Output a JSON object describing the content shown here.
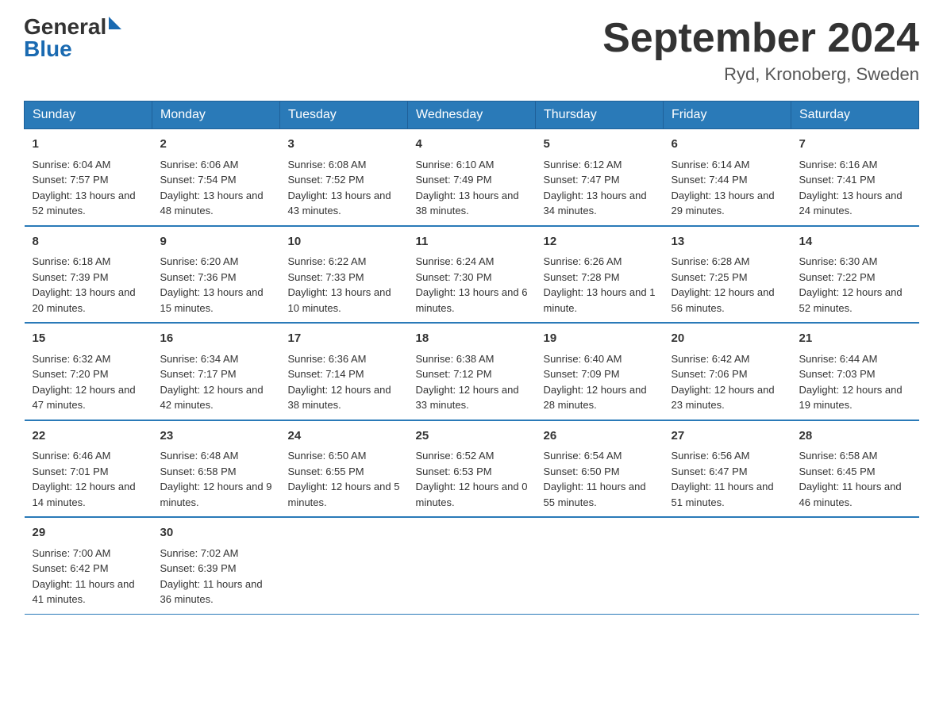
{
  "logo": {
    "general": "General",
    "blue": "Blue"
  },
  "title": "September 2024",
  "location": "Ryd, Kronoberg, Sweden",
  "days_of_week": [
    "Sunday",
    "Monday",
    "Tuesday",
    "Wednesday",
    "Thursday",
    "Friday",
    "Saturday"
  ],
  "weeks": [
    [
      {
        "day": "1",
        "sunrise": "6:04 AM",
        "sunset": "7:57 PM",
        "daylight": "13 hours and 52 minutes."
      },
      {
        "day": "2",
        "sunrise": "6:06 AM",
        "sunset": "7:54 PM",
        "daylight": "13 hours and 48 minutes."
      },
      {
        "day": "3",
        "sunrise": "6:08 AM",
        "sunset": "7:52 PM",
        "daylight": "13 hours and 43 minutes."
      },
      {
        "day": "4",
        "sunrise": "6:10 AM",
        "sunset": "7:49 PM",
        "daylight": "13 hours and 38 minutes."
      },
      {
        "day": "5",
        "sunrise": "6:12 AM",
        "sunset": "7:47 PM",
        "daylight": "13 hours and 34 minutes."
      },
      {
        "day": "6",
        "sunrise": "6:14 AM",
        "sunset": "7:44 PM",
        "daylight": "13 hours and 29 minutes."
      },
      {
        "day": "7",
        "sunrise": "6:16 AM",
        "sunset": "7:41 PM",
        "daylight": "13 hours and 24 minutes."
      }
    ],
    [
      {
        "day": "8",
        "sunrise": "6:18 AM",
        "sunset": "7:39 PM",
        "daylight": "13 hours and 20 minutes."
      },
      {
        "day": "9",
        "sunrise": "6:20 AM",
        "sunset": "7:36 PM",
        "daylight": "13 hours and 15 minutes."
      },
      {
        "day": "10",
        "sunrise": "6:22 AM",
        "sunset": "7:33 PM",
        "daylight": "13 hours and 10 minutes."
      },
      {
        "day": "11",
        "sunrise": "6:24 AM",
        "sunset": "7:30 PM",
        "daylight": "13 hours and 6 minutes."
      },
      {
        "day": "12",
        "sunrise": "6:26 AM",
        "sunset": "7:28 PM",
        "daylight": "13 hours and 1 minute."
      },
      {
        "day": "13",
        "sunrise": "6:28 AM",
        "sunset": "7:25 PM",
        "daylight": "12 hours and 56 minutes."
      },
      {
        "day": "14",
        "sunrise": "6:30 AM",
        "sunset": "7:22 PM",
        "daylight": "12 hours and 52 minutes."
      }
    ],
    [
      {
        "day": "15",
        "sunrise": "6:32 AM",
        "sunset": "7:20 PM",
        "daylight": "12 hours and 47 minutes."
      },
      {
        "day": "16",
        "sunrise": "6:34 AM",
        "sunset": "7:17 PM",
        "daylight": "12 hours and 42 minutes."
      },
      {
        "day": "17",
        "sunrise": "6:36 AM",
        "sunset": "7:14 PM",
        "daylight": "12 hours and 38 minutes."
      },
      {
        "day": "18",
        "sunrise": "6:38 AM",
        "sunset": "7:12 PM",
        "daylight": "12 hours and 33 minutes."
      },
      {
        "day": "19",
        "sunrise": "6:40 AM",
        "sunset": "7:09 PM",
        "daylight": "12 hours and 28 minutes."
      },
      {
        "day": "20",
        "sunrise": "6:42 AM",
        "sunset": "7:06 PM",
        "daylight": "12 hours and 23 minutes."
      },
      {
        "day": "21",
        "sunrise": "6:44 AM",
        "sunset": "7:03 PM",
        "daylight": "12 hours and 19 minutes."
      }
    ],
    [
      {
        "day": "22",
        "sunrise": "6:46 AM",
        "sunset": "7:01 PM",
        "daylight": "12 hours and 14 minutes."
      },
      {
        "day": "23",
        "sunrise": "6:48 AM",
        "sunset": "6:58 PM",
        "daylight": "12 hours and 9 minutes."
      },
      {
        "day": "24",
        "sunrise": "6:50 AM",
        "sunset": "6:55 PM",
        "daylight": "12 hours and 5 minutes."
      },
      {
        "day": "25",
        "sunrise": "6:52 AM",
        "sunset": "6:53 PM",
        "daylight": "12 hours and 0 minutes."
      },
      {
        "day": "26",
        "sunrise": "6:54 AM",
        "sunset": "6:50 PM",
        "daylight": "11 hours and 55 minutes."
      },
      {
        "day": "27",
        "sunrise": "6:56 AM",
        "sunset": "6:47 PM",
        "daylight": "11 hours and 51 minutes."
      },
      {
        "day": "28",
        "sunrise": "6:58 AM",
        "sunset": "6:45 PM",
        "daylight": "11 hours and 46 minutes."
      }
    ],
    [
      {
        "day": "29",
        "sunrise": "7:00 AM",
        "sunset": "6:42 PM",
        "daylight": "11 hours and 41 minutes."
      },
      {
        "day": "30",
        "sunrise": "7:02 AM",
        "sunset": "6:39 PM",
        "daylight": "11 hours and 36 minutes."
      },
      null,
      null,
      null,
      null,
      null
    ]
  ]
}
